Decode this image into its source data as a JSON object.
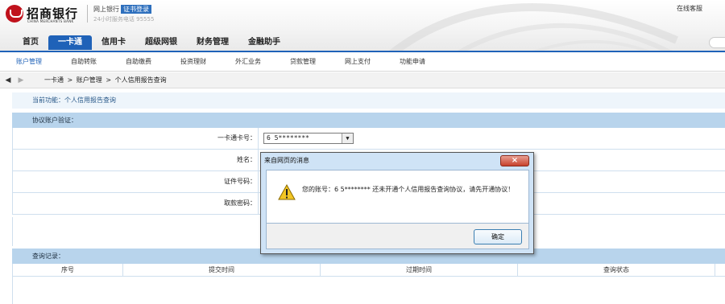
{
  "header": {
    "logo_text": "招商银行",
    "logo_sub": "CHINA MERCHANTS BANK",
    "site_title": "网上银行",
    "cert_badge": "证书登录",
    "phone": "24小时服务电话 95555",
    "online_service": "在线客服"
  },
  "main_nav": [
    "首页",
    "一卡通",
    "信用卡",
    "超级网银",
    "财务管理",
    "金融助手"
  ],
  "sub_nav": [
    "账户管理",
    "自助转账",
    "自助缴费",
    "投资理财",
    "外汇业务",
    "贷款管理",
    "网上支付",
    "功能申请"
  ],
  "breadcrumb": {
    "back_icon": "◀",
    "forward_icon": "▶",
    "level1": "一卡通",
    "sep": ">",
    "level2": "账户管理",
    "level3": "个人信用报告查询"
  },
  "current_function": "当前功能：个人信用报告查询",
  "verify_section": "协议账户验证：",
  "form": {
    "card_label": "一卡通卡号：",
    "card_value": "6    5********",
    "name_label": "姓名：",
    "id_label": "证件号码：",
    "code_label": "取款密码："
  },
  "records_section": "查询记录：",
  "table_headers": [
    "序号",
    "提交时间",
    "过期时间",
    "查询状态"
  ],
  "dialog": {
    "title": "来自网页的消息",
    "close": "×",
    "message": "您的账号：6    5********      还未开通个人信用报告查询协议，请先开通协议！",
    "ok": "确定"
  },
  "colors": {
    "brand_red": "#c0121c",
    "nav_blue": "#1f62b8",
    "section_blue": "#b8d4ec"
  }
}
